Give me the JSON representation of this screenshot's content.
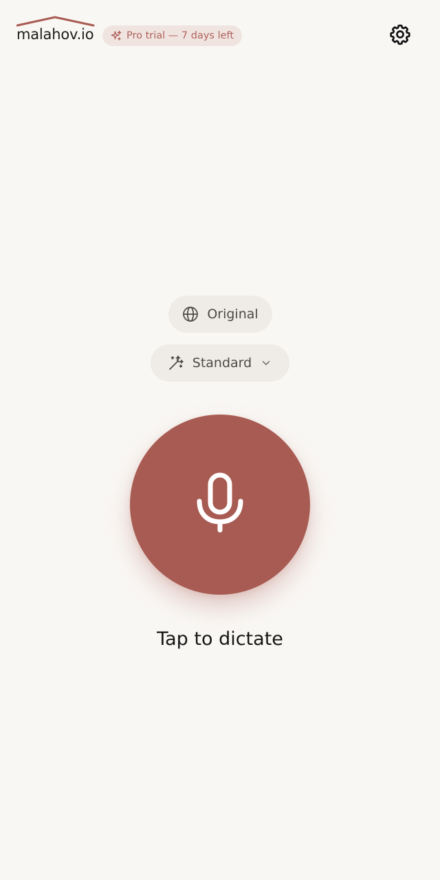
{
  "header": {
    "logo_text": "malahov.io",
    "trial_badge": "Pro trial — 7 days left",
    "trial_icon": "sparkles-icon",
    "settings_icon": "gear-icon"
  },
  "language_pill": {
    "label": "Original",
    "icon": "globe-icon"
  },
  "mode_select": {
    "label": "Standard",
    "icon": "magic-wand-icon",
    "chevron": "chevron-down-icon"
  },
  "record": {
    "icon": "microphone-icon",
    "caption": "Tap to dictate"
  },
  "colors": {
    "accent": "#a85b52",
    "background": "#f9f7f4",
    "badge_bg": "#f0e4e0",
    "badge_text": "#b0625c",
    "pill_bg": "#efebe7"
  }
}
